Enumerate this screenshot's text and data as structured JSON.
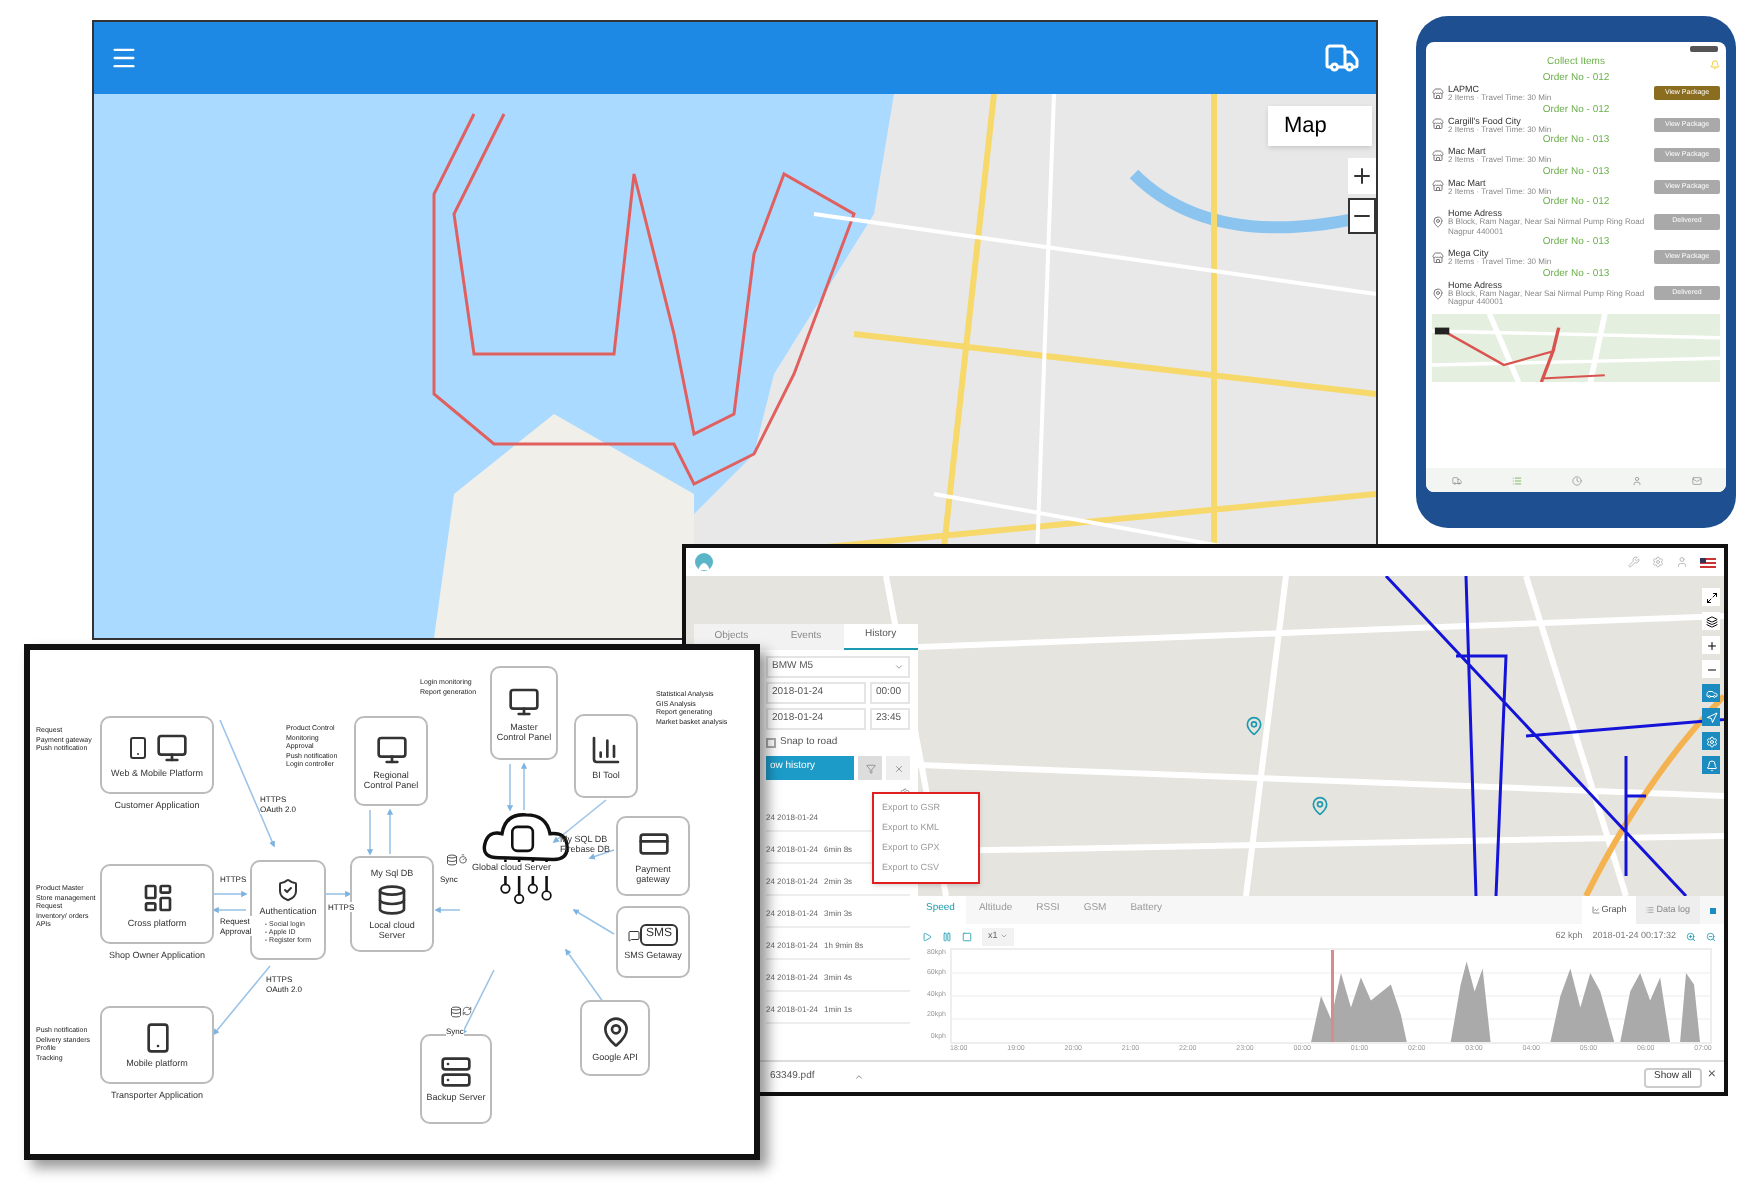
{
  "web_app": {
    "map_type_button": "Map"
  },
  "phone": {
    "title": "Collect Items",
    "orders": [
      {
        "order": "Order No - 012",
        "kind": "store",
        "name": "LAPMC",
        "detail": "2 Items · Travel Time: 30 Min",
        "action": "View Package",
        "highlighted": true
      },
      {
        "order": "Order No - 012",
        "kind": "store",
        "name": "Cargill's Food City",
        "detail": "2 Items · Travel Time: 30 Min",
        "action": "View Package",
        "highlighted": false
      },
      {
        "order": "Order No - 013",
        "kind": "store",
        "name": "Mac Mart",
        "detail": "2 Items · Travel Time: 30 Min",
        "action": "View Package",
        "highlighted": false
      },
      {
        "order": "Order No - 013",
        "kind": "store",
        "name": "Mac Mart",
        "detail": "2 Items · Travel Time: 30 Min",
        "action": "View Package",
        "highlighted": false
      },
      {
        "order": "Order No - 012",
        "kind": "address",
        "name": "Home Adress",
        "detail": "B Block, Ram Nagar, Near Sai Nirmal Pump Ring Road Nagpur 440001",
        "action": "Delivered",
        "highlighted": false
      },
      {
        "order": "Order No - 013",
        "kind": "store",
        "name": "Mega City",
        "detail": "2 Items · Travel Time: 30 Min",
        "action": "View Package",
        "highlighted": false
      },
      {
        "order": "Order No - 013",
        "kind": "address",
        "name": "Home Adress",
        "detail": "B Block, Ram Nagar, Near Sai Nirmal Pump Ring Road Nagpur 440001",
        "action": "Delivered",
        "highlighted": false
      }
    ]
  },
  "tracking": {
    "tabs": [
      {
        "label": "Objects",
        "selected": false
      },
      {
        "label": "Events",
        "selected": false
      },
      {
        "label": "History",
        "selected": true
      }
    ],
    "object_select": "BMW M5",
    "from": {
      "date": "2018-01-24",
      "time": "00:00"
    },
    "to": {
      "date": "2018-01-24",
      "time": "23:45"
    },
    "snap_to_road": {
      "label": "Snap to road",
      "checked": false
    },
    "show_button": "ow history",
    "export_menu": [
      "Export to GSR",
      "Export to KML",
      "Export to GPX",
      "Export to CSV"
    ],
    "rows": [
      {
        "date": "24 2018-01-24"
      },
      {
        "date": "24 2018-01-24",
        "duration": "6min 8s"
      },
      {
        "date": "24 2018-01-24",
        "duration": "2min 3s"
      },
      {
        "date": "24 2018-01-24",
        "duration": "3min 3s"
      },
      {
        "date": "24 2018-01-24",
        "duration": "1h 9min 8s"
      },
      {
        "date": "24 2018-01-24",
        "duration": "3min 4s"
      },
      {
        "date": "24 2018-01-24",
        "duration": "1min 1s"
      }
    ],
    "graph": {
      "tabs": [
        {
          "label": "Speed",
          "selected": true
        },
        {
          "label": "Altitude",
          "selected": false
        },
        {
          "label": "RSSI",
          "selected": false
        },
        {
          "label": "GSM",
          "selected": false
        },
        {
          "label": "Battery",
          "selected": false
        }
      ],
      "views": [
        {
          "label": "Graph",
          "selected": true
        },
        {
          "label": "Data log",
          "selected": false
        }
      ],
      "speed_select": "x1",
      "reading": "62 kph",
      "timestamp": "2018-01-24 00:17:32",
      "yticks": [
        "80kph",
        "60kph",
        "40kph",
        "20kph",
        "0kph"
      ],
      "xticks": [
        "18:00",
        "19:00",
        "20:00",
        "21:00",
        "22:00",
        "23:00",
        "00:00",
        "01:00",
        "02:00",
        "03:00",
        "04:00",
        "05:00",
        "06:00",
        "07:00"
      ]
    },
    "download": {
      "file": "63349.pdf",
      "show_all": "Show all",
      "close": "×"
    }
  },
  "diagram": {
    "nodes": [
      {
        "kind": "web",
        "label": "Web & Mobile Platform",
        "caption": "Customer Application"
      },
      {
        "kind": "cross",
        "label": "Cross platform",
        "caption": "Shop Owner Application"
      },
      {
        "kind": "mobile",
        "label": "Mobile platform",
        "caption": "Transporter Application"
      },
      {
        "kind": "auth",
        "label": "Authentication",
        "items": [
          "- Social login",
          "- Apple ID",
          "- Register form"
        ]
      },
      {
        "kind": "panel",
        "label": "Regional Control Panel"
      },
      {
        "kind": "local",
        "title": "My Sql DB",
        "label": "Local cloud Server"
      },
      {
        "kind": "panel",
        "label": "Master Control Panel"
      },
      {
        "kind": "bi",
        "label": "BI Tool"
      },
      {
        "kind": "global",
        "lines": [
          "My SQL DB",
          "Firebase DB"
        ],
        "label": "Global cloud Server"
      },
      {
        "kind": "payment",
        "label": "Payment gateway"
      },
      {
        "kind": "sms",
        "badge": "SMS",
        "label": "SMS Getaway"
      },
      {
        "kind": "map",
        "label": "Google API"
      },
      {
        "kind": "backup",
        "label": "Backup Server"
      }
    ],
    "notes": [
      [
        "Request",
        "Payment gateway",
        "Push notification"
      ],
      [
        "Product Master",
        "Store management",
        "Request",
        "Inventory/ orders",
        "APIs"
      ],
      [
        "Push notification",
        "Delivery standers",
        "Profile",
        "Tracking"
      ],
      [
        "Product Control",
        "Monitoring",
        "Approval",
        "Push notification",
        "Login controller"
      ],
      [
        "Login monitoring",
        "Report generation"
      ],
      [
        "Statistical Analysis",
        "GIS Analysis",
        "Report generating",
        "Market basket analysis"
      ]
    ],
    "edge_labels": [
      [
        "HTTPS",
        "OAuth 2.0"
      ],
      [
        "HTTPS"
      ],
      [
        "Request",
        "Approval"
      ],
      [
        "HTTPS"
      ],
      [
        "HTTPS",
        "OAuth 2.0"
      ],
      [
        "Sync"
      ],
      [
        "Sync"
      ]
    ]
  }
}
